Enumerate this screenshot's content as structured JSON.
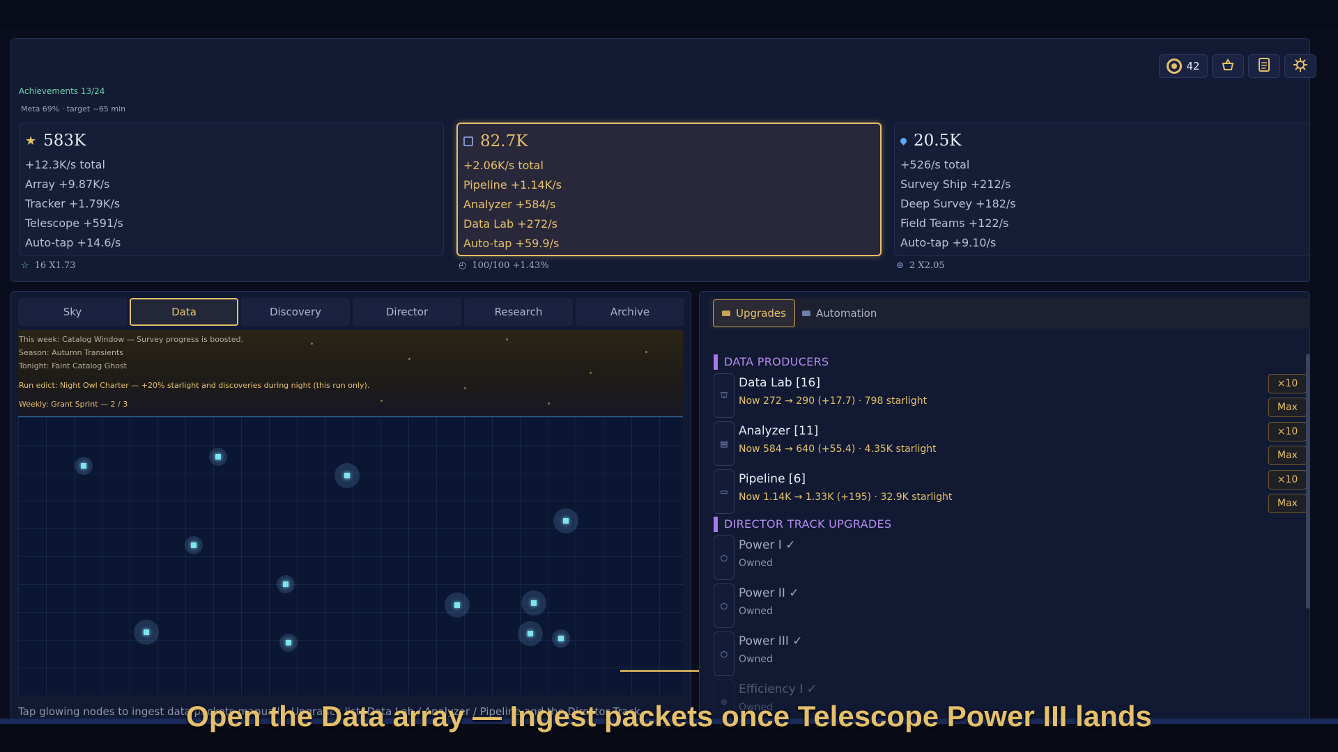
{
  "hud": {
    "tokens": "42"
  },
  "achievements": "Achievements 13/24",
  "meta": "Meta 69% · target ~65 min",
  "cards": [
    {
      "value": "583K",
      "total": "+12.3K/s total",
      "rows": [
        "Array  +9.87K/s",
        "Tracker  +1.79K/s",
        "Telescope  +591/s",
        "Auto-tap  +14.6/s"
      ],
      "foot": "16  X1.73",
      "icon": "star-icon"
    },
    {
      "value": "82.7K",
      "total": "+2.06K/s total",
      "rows": [
        "Pipeline  +1.14K/s",
        "Analyzer  +584/s",
        "Data Lab  +272/s",
        "Auto-tap  +59.9/s"
      ],
      "foot": "100/100  +1.43%",
      "icon": "data-icon"
    },
    {
      "value": "20.5K",
      "total": "+526/s total",
      "rows": [
        "Survey Ship  +212/s",
        "Deep Survey  +182/s",
        "Field Teams  +122/s",
        "Auto-tap  +9.10/s"
      ],
      "foot": "2  X2.05",
      "icon": "drop-icon"
    }
  ],
  "tabs": [
    "Sky",
    "Data",
    "Discovery",
    "Director",
    "Research",
    "Archive"
  ],
  "info": {
    "week": "This week: Catalog Window — Survey progress is boosted.",
    "season": "Season: Autumn Transients",
    "tonight": "Tonight: Faint Catalog Ghost",
    "edict": "Run edict: Night Owl Charter — +20% starlight and discoveries during night (this run only).",
    "weekly": "Weekly: Grant Sprint — 2 / 3"
  },
  "hint": "Tap glowing nodes to ingest data packets manually. Upgrades list: Data Lab / Analyzer / Pipeline and the Director Track.",
  "right_tabs": [
    "Upgrades",
    "Automation"
  ],
  "sections": {
    "producers": "DATA PRODUCERS",
    "director": "DIRECTOR TRACK UPGRADES"
  },
  "producers": [
    {
      "title": "Data Lab  [16]",
      "sub": "Now 272 → 290 (+17.7)  ·  798 starlight"
    },
    {
      "title": "Analyzer  [11]",
      "sub": "Now 584 → 640 (+55.4)  ·  4.35K starlight"
    },
    {
      "title": "Pipeline  [6]",
      "sub": "Now 1.14K → 1.33K (+195)  ·  32.9K starlight"
    }
  ],
  "buy": {
    "x10": "×10",
    "max": "Max"
  },
  "director": [
    {
      "title": "Power I  ✓",
      "sub": "Owned"
    },
    {
      "title": "Power II  ✓",
      "sub": "Owned"
    },
    {
      "title": "Power III  ✓",
      "sub": "Owned"
    },
    {
      "title": "Efficiency I  ✓",
      "sub": "Owned"
    }
  ],
  "caption": "Open the Data array — Ingest packets once Telescope Power III lands",
  "colors": {
    "accent_gold": "#e5c06a",
    "section_purple": "#b48cf0",
    "node_cyan": "#7fe3f2"
  }
}
